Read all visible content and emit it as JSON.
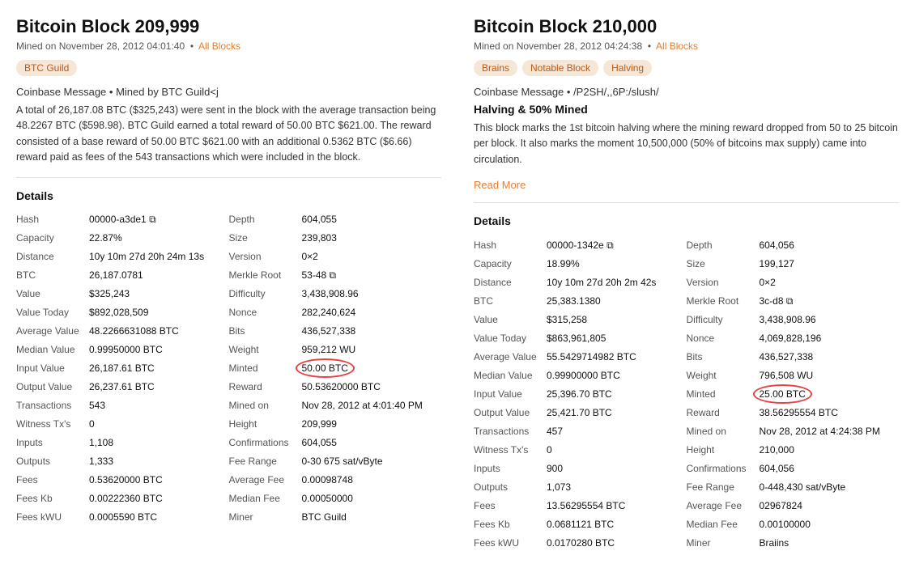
{
  "left": {
    "title": "Bitcoin Block 209,999",
    "mined_on": "Mined on November 28, 2012 04:01:40",
    "all_blocks": "All Blocks",
    "tags": [
      "BTC Guild"
    ],
    "coinbase_label": "Coinbase Message",
    "coinbase_value": " • Mined by BTC Guild<j",
    "description": "A total of 26,187.08 BTC ($325,243) were sent in the block with the average transaction being 48.2267 BTC ($598.98). BTC Guild earned a total reward of 50.00 BTC $621.00. The reward consisted of a base reward of 50.00 BTC $621.00 with an additional 0.5362 BTC ($6.66) reward paid as fees of the 543 transactions which were included in the block.",
    "details_title": "Details",
    "left_col": [
      {
        "key": "Hash",
        "val": "00000-a3de1 ⧉"
      },
      {
        "key": "Capacity",
        "val": "22.87%"
      },
      {
        "key": "Distance",
        "val": "10y 10m 27d 20h 24m 13s"
      },
      {
        "key": "BTC",
        "val": "26,187.0781"
      },
      {
        "key": "Value",
        "val": "$325,243"
      },
      {
        "key": "Value Today",
        "val": "$892,028,509"
      },
      {
        "key": "Average Value",
        "val": "48.2266631088 BTC"
      },
      {
        "key": "Median Value",
        "val": "0.99950000 BTC"
      },
      {
        "key": "Input Value",
        "val": "26,187.61 BTC"
      },
      {
        "key": "Output Value",
        "val": "26,237.61 BTC"
      },
      {
        "key": "Transactions",
        "val": "543"
      },
      {
        "key": "Witness Tx's",
        "val": "0"
      },
      {
        "key": "Inputs",
        "val": "1,108"
      },
      {
        "key": "Outputs",
        "val": "1,333"
      },
      {
        "key": "Fees",
        "val": "0.53620000 BTC"
      },
      {
        "key": "Fees Kb",
        "val": "0.00222360 BTC"
      },
      {
        "key": "Fees kWU",
        "val": "0.0005590 BTC"
      }
    ],
    "right_col": [
      {
        "key": "Depth",
        "val": "604,055"
      },
      {
        "key": "Size",
        "val": "239,803"
      },
      {
        "key": "Version",
        "val": "0×2"
      },
      {
        "key": "Merkle Root",
        "val": "53-48 ⧉"
      },
      {
        "key": "Difficulty",
        "val": "3,438,908.96"
      },
      {
        "key": "Nonce",
        "val": "282,240,624"
      },
      {
        "key": "Bits",
        "val": "436,527,338"
      },
      {
        "key": "Weight",
        "val": "959,212 WU"
      },
      {
        "key": "Minted",
        "val": "50.00 BTC",
        "highlight": true
      },
      {
        "key": "Reward",
        "val": "50.53620000 BTC"
      },
      {
        "key": "Mined on",
        "val": "Nov 28, 2012 at 4:01:40 PM"
      },
      {
        "key": "Height",
        "val": "209,999"
      },
      {
        "key": "Confirmations",
        "val": "604,055"
      },
      {
        "key": "Fee Range",
        "val": "0-30 675 sat/vByte"
      },
      {
        "key": "Average Fee",
        "val": "0.00098748"
      },
      {
        "key": "Median Fee",
        "val": "0.00050000"
      },
      {
        "key": "Miner",
        "val": "BTC Guild"
      }
    ]
  },
  "right": {
    "title": "Bitcoin Block 210,000",
    "mined_on": "Mined on November 28, 2012 04:24:38",
    "all_blocks": "All Blocks",
    "tags": [
      "Brains",
      "Notable Block",
      "Halving"
    ],
    "coinbase_label": "Coinbase Message",
    "coinbase_value": " • /P2SH/,,6P:/slush/",
    "halving_title": "Halving & 50% Mined",
    "description": "This block marks the 1st bitcoin halving where the mining reward dropped from 50 to 25 bitcoin per block. It also marks the moment 10,500,000 (50% of bitcoins max supply) came into circulation.",
    "read_more": "Read More",
    "details_title": "Details",
    "left_col": [
      {
        "key": "Hash",
        "val": "00000-1342e ⧉"
      },
      {
        "key": "Capacity",
        "val": "18.99%"
      },
      {
        "key": "Distance",
        "val": "10y 10m 27d 20h 2m 42s"
      },
      {
        "key": "BTC",
        "val": "25,383.1380"
      },
      {
        "key": "Value",
        "val": "$315,258"
      },
      {
        "key": "Value Today",
        "val": "$863,961,805"
      },
      {
        "key": "Average Value",
        "val": "55.5429714982 BTC"
      },
      {
        "key": "Median Value",
        "val": "0.99900000 BTC"
      },
      {
        "key": "Input Value",
        "val": "25,396.70 BTC"
      },
      {
        "key": "Output Value",
        "val": "25,421.70 BTC"
      },
      {
        "key": "Transactions",
        "val": "457"
      },
      {
        "key": "Witness Tx's",
        "val": "0"
      },
      {
        "key": "Inputs",
        "val": "900"
      },
      {
        "key": "Outputs",
        "val": "1,073"
      },
      {
        "key": "Fees",
        "val": "13.56295554 BTC"
      },
      {
        "key": "Fees Kb",
        "val": "0.0681121 BTC"
      },
      {
        "key": "Fees kWU",
        "val": "0.0170280 BTC"
      }
    ],
    "right_col": [
      {
        "key": "Depth",
        "val": "604,056"
      },
      {
        "key": "Size",
        "val": "199,127"
      },
      {
        "key": "Version",
        "val": "0×2"
      },
      {
        "key": "Merkle Root",
        "val": "3c-d8 ⧉"
      },
      {
        "key": "Difficulty",
        "val": "3,438,908.96"
      },
      {
        "key": "Nonce",
        "val": "4,069,828,196"
      },
      {
        "key": "Bits",
        "val": "436,527,338"
      },
      {
        "key": "Weight",
        "val": "796,508 WU"
      },
      {
        "key": "Minted",
        "val": "25.00 BTC",
        "highlight": true
      },
      {
        "key": "Reward",
        "val": "38.56295554 BTC"
      },
      {
        "key": "Mined on",
        "val": "Nov 28, 2012 at 4:24:38 PM"
      },
      {
        "key": "Height",
        "val": "210,000"
      },
      {
        "key": "Confirmations",
        "val": "604,056"
      },
      {
        "key": "Fee Range",
        "val": "0-448,430 sat/vByte"
      },
      {
        "key": "Average Fee",
        "val": "02967824"
      },
      {
        "key": "Median Fee",
        "val": "0.00100000"
      },
      {
        "key": "Miner",
        "val": "Braiins"
      }
    ]
  }
}
